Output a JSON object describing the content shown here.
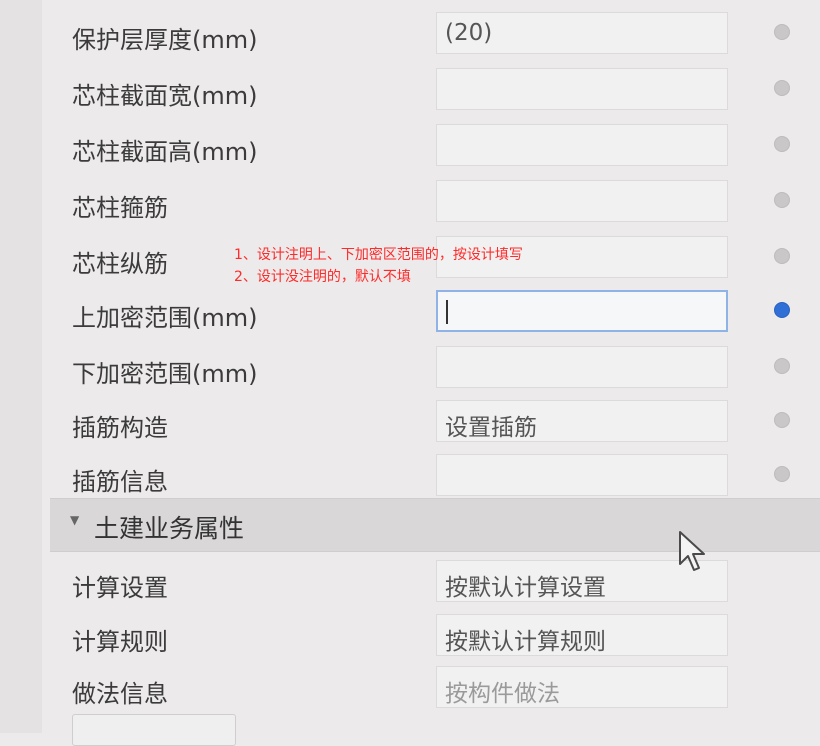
{
  "properties": [
    {
      "label": "保护层厚度(mm)",
      "value": "(20)",
      "state": "normal"
    },
    {
      "label": "芯柱截面宽(mm)",
      "value": "",
      "state": "normal"
    },
    {
      "label": "芯柱截面高(mm)",
      "value": "",
      "state": "normal"
    },
    {
      "label": "芯柱箍筋",
      "value": "",
      "state": "normal"
    },
    {
      "label": "芯柱纵筋",
      "value": "",
      "state": "normal"
    },
    {
      "label": "上加密范围(mm)",
      "value": "",
      "state": "active"
    },
    {
      "label": "下加密范围(mm)",
      "value": "",
      "state": "normal"
    },
    {
      "label": "插筋构造",
      "value": "设置插筋",
      "state": "normal"
    },
    {
      "label": "插筋信息",
      "value": "",
      "state": "normal"
    }
  ],
  "section": {
    "title": "土建业务属性",
    "expanded": true
  },
  "section_properties": [
    {
      "label": "计算设置",
      "value": "按默认计算设置",
      "placeholder": false
    },
    {
      "label": "计算规则",
      "value": "按默认计算规则",
      "placeholder": false
    },
    {
      "label": "做法信息",
      "value": "按构件做法",
      "placeholder": true
    }
  ],
  "annotation": {
    "line1": "1、设计注明上、下加密区范围的，按设计填写",
    "line2": "2、设计没注明的，默认不填",
    "color": "#ff2a2a"
  },
  "colors": {
    "active_dot": "#2f6fd6",
    "inactive_dot": "#c9c7c7",
    "active_border": "#8fb3e6"
  }
}
